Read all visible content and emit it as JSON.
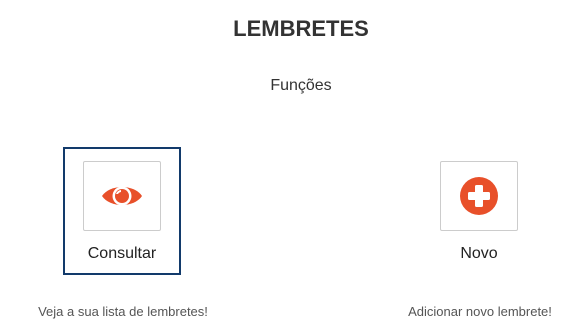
{
  "header": {
    "title": "LEMBRETES",
    "subtitle": "Funções"
  },
  "functions": [
    {
      "label": "Consultar",
      "description": "Veja a sua lista de lembretes!",
      "icon": "eye-icon",
      "selected": true
    },
    {
      "label": "Novo",
      "description": "Adicionar novo lembrete!",
      "icon": "plus-circle-icon",
      "selected": false
    }
  ],
  "colors": {
    "accent": "#e8502a",
    "selected_border": "#123a6b"
  }
}
